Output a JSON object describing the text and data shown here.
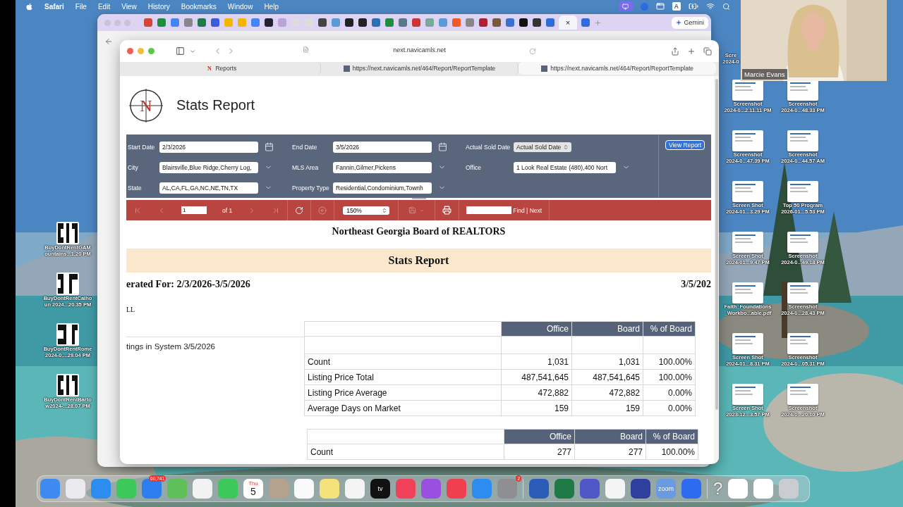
{
  "menu_bar": {
    "app": "Safari",
    "items": [
      "File",
      "Edit",
      "View",
      "History",
      "Bookmarks",
      "Window",
      "Help"
    ],
    "input_source": "A"
  },
  "back_window": {
    "tab_close": "×",
    "assistant": "Gemini"
  },
  "browser": {
    "address": "next.navicamls.net",
    "reports_favicon": "N",
    "tabs": [
      {
        "title": "Reports",
        "selected": false
      },
      {
        "title": "https://next.navicamls.net/464/Report/ReportTemplate",
        "selected": false
      },
      {
        "title": "https://next.navicamls.net/464/Report/ReportTemplate",
        "selected": true
      }
    ]
  },
  "report": {
    "logo_letter": "N",
    "title": "Stats Report",
    "filters": [
      {
        "label": "Start Date",
        "value": "2/3/2026",
        "kind": "date"
      },
      {
        "label": "End Date",
        "value": "3/5/2026",
        "kind": "date"
      },
      {
        "label": "Actual Sold Date",
        "value": "Actual Sold Date",
        "kind": "select"
      },
      {
        "label": "City",
        "value": "Blairsville,Blue Ridge,Cherry Log,",
        "kind": "multi"
      },
      {
        "label": "MLS Area",
        "value": "Fannin,Gilmer,Pickens",
        "kind": "multi"
      },
      {
        "label": "Office",
        "value": "1 Look Real Estate (480),400 Nort",
        "kind": "multi"
      },
      {
        "label": "State",
        "value": "AL,CA,FL,GA,NC,NE,TN,TX",
        "kind": "multi"
      },
      {
        "label": "Property Type",
        "value": "Residential,Condominium,Townh",
        "kind": "multi"
      }
    ],
    "view_button": "View Report",
    "toolbar": {
      "page": "1",
      "page_count": "of 1",
      "zoom": "150%",
      "find": "Find | Next"
    },
    "board": "Northeast Georgia Board of REALTORS",
    "band_title": "Stats Report",
    "generated": "erated For: 2/3/2026-3/5/2026",
    "report_date": "3/5/202",
    "group": "LL",
    "sections": [
      {
        "label": "tings in System 3/5/2026",
        "columns": [
          "",
          "Office",
          "Board",
          "% of Board"
        ],
        "rows": [
          [
            "Count",
            "1,031",
            "1,031",
            "100.00%"
          ],
          [
            "Listing Price Total",
            "487,541,645",
            "487,541,645",
            "100.00%"
          ],
          [
            "Listing Price Average",
            "472,882",
            "472,882",
            "0.00%"
          ],
          [
            "Average Days on Market",
            "159",
            "159",
            "0.00%"
          ]
        ]
      },
      {
        "columns": [
          "",
          "Office",
          "Board",
          "% of Board"
        ],
        "rows": [
          [
            "Count",
            "277",
            "277",
            "100.00%"
          ]
        ]
      }
    ]
  },
  "webcam": {
    "name": "Marcie Evans"
  },
  "desktop_left": [
    {
      "lines": [
        "BuyDontRentGAM",
        "ountains...1.20 PM"
      ]
    },
    {
      "lines": [
        "BuyDontRentCalho",
        "un 2024...20.35 PM"
      ]
    },
    {
      "lines": [
        "BuyDontRentRome",
        "2024-0....29.04 PM"
      ]
    },
    {
      "lines": [
        "BuyDontRentBarto",
        "w2024-...28.07 PM"
      ]
    }
  ],
  "desktop_right": [
    {
      "kind": "label",
      "lines": [
        "Scre",
        "2024-0"
      ]
    },
    {
      "kind": "spacer"
    },
    {
      "kind": "file",
      "lines": [
        "Screenshot",
        "2024-0...2.11.11 PM"
      ]
    },
    {
      "kind": "file",
      "lines": [
        "Screenshot",
        "2024-0...48.33 PM"
      ]
    },
    {
      "kind": "file",
      "lines": [
        "Screenshot",
        "2024-0...47.39 PM"
      ]
    },
    {
      "kind": "file",
      "lines": [
        "Screenshot",
        "2024-0...44.57 AM"
      ]
    },
    {
      "kind": "file",
      "lines": [
        "Screen Shot",
        "2024-01...3.29 PM"
      ]
    },
    {
      "kind": "file",
      "lines": [
        "Top 50 Program",
        "2026-01...5.53 PM"
      ]
    },
    {
      "kind": "file",
      "lines": [
        "Screen Shot",
        "2024-01...9.47 PM"
      ]
    },
    {
      "kind": "file",
      "lines": [
        "Screenshot",
        "2024-0...49.18 PM"
      ]
    },
    {
      "kind": "file",
      "lines": [
        "Faith_Foundations",
        "_Workbo...able.pdf"
      ]
    },
    {
      "kind": "file",
      "lines": [
        "Screenshot",
        "2024-0...28.43 PM"
      ]
    },
    {
      "kind": "file",
      "lines": [
        "Screen Shot",
        "2024-01...8.31 PM"
      ]
    },
    {
      "kind": "file",
      "lines": [
        "Screenshot",
        "2024-0...05.31 PM"
      ]
    },
    {
      "kind": "file",
      "lines": [
        "Screen Shot",
        "2023-12...3.57 PM"
      ]
    },
    {
      "kind": "file",
      "lines": [
        "Screenshot",
        "2024-0...20.10 PM"
      ]
    }
  ],
  "dock": {
    "mail_badge": "60,741",
    "calendar_day": "Thu",
    "calendar_date": "5",
    "tv_label": "tv",
    "settings_badge": "2",
    "meeting_label": "zoom",
    "help": "?"
  }
}
